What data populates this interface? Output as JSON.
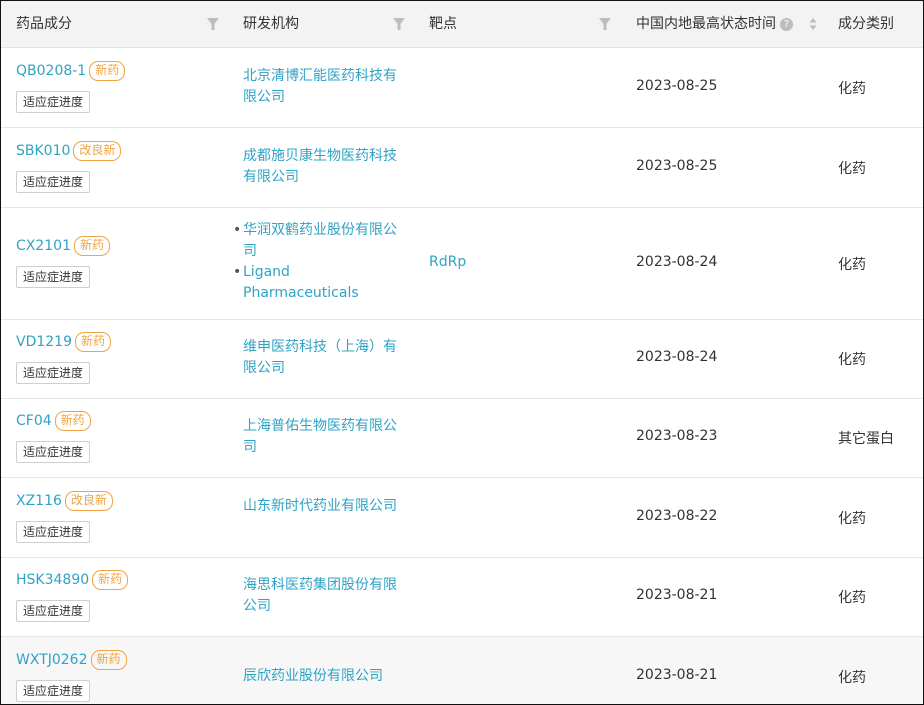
{
  "columns": {
    "drug": "药品成分",
    "org": "研发机构",
    "target": "靶点",
    "date": "中国内地最高状态时间",
    "date_help": "?",
    "category": "成分类别"
  },
  "rows": [
    {
      "name": "QB0208-1",
      "badge": "新药",
      "progress": "适应症进度",
      "orgs": [
        "北京清博汇能医药科技有限公司"
      ],
      "target": "",
      "date": "2023-08-25",
      "category": "化药"
    },
    {
      "name": "SBK010",
      "badge": "改良新",
      "progress": "适应症进度",
      "orgs": [
        "成都施贝康生物医药科技有限公司"
      ],
      "target": "",
      "date": "2023-08-25",
      "category": "化药"
    },
    {
      "name": "CX2101",
      "badge": "新药",
      "progress": "适应症进度",
      "orgs": [
        "华润双鹤药业股份有限公司",
        "Ligand Pharmaceuticals"
      ],
      "target": "RdRp",
      "date": "2023-08-24",
      "category": "化药"
    },
    {
      "name": "VD1219",
      "badge": "新药",
      "progress": "适应症进度",
      "orgs": [
        "维申医药科技（上海）有限公司"
      ],
      "target": "",
      "date": "2023-08-24",
      "category": "化药"
    },
    {
      "name": "CF04",
      "badge": "新药",
      "progress": "适应症进度",
      "orgs": [
        "上海普佑生物医药有限公司"
      ],
      "target": "",
      "date": "2023-08-23",
      "category": "其它蛋白"
    },
    {
      "name": "XZ116",
      "badge": "改良新",
      "progress": "适应症进度",
      "orgs": [
        "山东新时代药业有限公司"
      ],
      "target": "",
      "date": "2023-08-22",
      "category": "化药"
    },
    {
      "name": "HSK34890",
      "badge": "新药",
      "progress": "适应症进度",
      "orgs": [
        "海思科医药集团股份有限公司"
      ],
      "target": "",
      "date": "2023-08-21",
      "category": "化药"
    },
    {
      "name": "WXTJ0262",
      "badge": "新药",
      "progress": "适应症进度",
      "orgs": [
        "辰欣药业股份有限公司"
      ],
      "target": "",
      "date": "2023-08-21",
      "category": "化药"
    }
  ]
}
